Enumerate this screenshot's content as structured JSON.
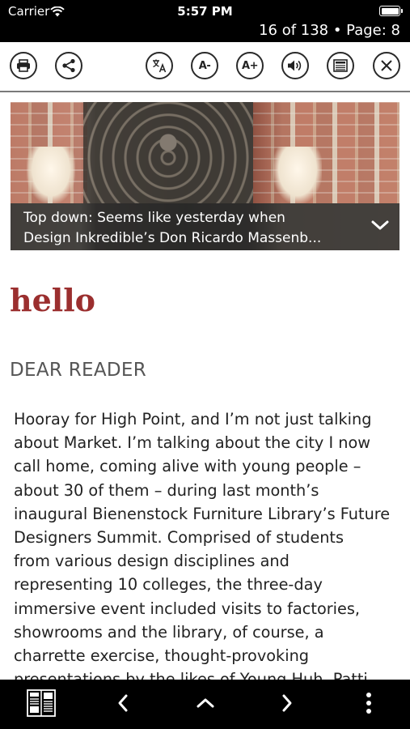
{
  "status_bar": {
    "carrier": "Carrier",
    "time": "5:57 PM",
    "page_indicator": "16 of 138 • Page: 8"
  },
  "toolbar": {
    "font_decrease_label": "A-",
    "font_increase_label": "A+",
    "icons": [
      "print-icon",
      "share-icon",
      "translate-icon",
      "font-decrease-icon",
      "font-increase-icon",
      "speaker-icon",
      "article-view-icon",
      "close-icon"
    ]
  },
  "hero": {
    "caption_line1": "Top down: Seems like yesterday when",
    "caption_line2": "Design Inkredible’s  Don Ricardo Massenb..."
  },
  "article": {
    "headline": "hello",
    "section_label": "DEAR READER",
    "body_lines": [
      "Hooray for High Point, and I’m not just talking",
      "about Market. I’m talking about the city I now",
      "call home, coming alive with young people –",
      "about 30 of them – during last month’s",
      "inaugural Bienenstock Furniture Library’s Future",
      "Designers Summit. Comprised of students",
      "from various design disciplines and",
      "representing 10 colleges, the three-day",
      "immersive event included visits to factories,",
      "showrooms and the library, of course, a",
      "charrette exercise, thought-provoking",
      "presentations by the likes of Young Huh, Patti"
    ]
  },
  "bottom_bar": {
    "icons": [
      "page-thumbnails-icon",
      "previous-icon",
      "up-icon",
      "next-icon",
      "more-icon"
    ]
  },
  "colors": {
    "headline": "#9b2f2f",
    "bars": "#000000"
  }
}
